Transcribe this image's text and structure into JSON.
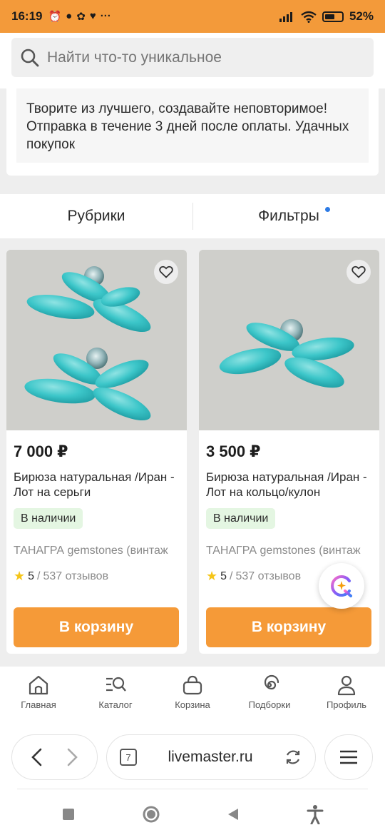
{
  "status_bar": {
    "time": "16:19",
    "battery": "52%",
    "more": "···"
  },
  "search": {
    "placeholder": "Найти что-то уникальное"
  },
  "shop_description": {
    "text": "Творите из лучшего, создавайте неповторимое! Отправка в течение 3 дней после оплаты. Удачных покупок"
  },
  "tabs": {
    "rubrics": "Рубрики",
    "filters": "Фильтры"
  },
  "products": [
    {
      "price": "7 000 ₽",
      "title": "Бирюза натуральная /Иран - Лот на серьги",
      "availability": "В наличии",
      "shop": "ТАНАГРА gemstones (винтаж",
      "rating": "5",
      "reviews": "537 отзывов",
      "cart_label": "В корзину"
    },
    {
      "price": "3 500 ₽",
      "title": "Бирюза натуральная /Иран - Лот на кольцо/кулон",
      "availability": "В наличии",
      "shop": "ТАНАГРА gemstones (винтаж",
      "rating": "5",
      "reviews": "537 отзывов",
      "cart_label": "В корзину"
    }
  ],
  "bottom_nav": {
    "home": "Главная",
    "catalog": "Каталог",
    "cart": "Корзина",
    "collections": "Подборки",
    "profile": "Профиль"
  },
  "browser": {
    "tab_count": "7",
    "url": "livemaster.ru"
  },
  "colors": {
    "status_bar": "#f39a3a",
    "cart_button": "#f59a38",
    "badge_bg": "#e4f6e2",
    "turquoise": "#3cc6c9"
  }
}
